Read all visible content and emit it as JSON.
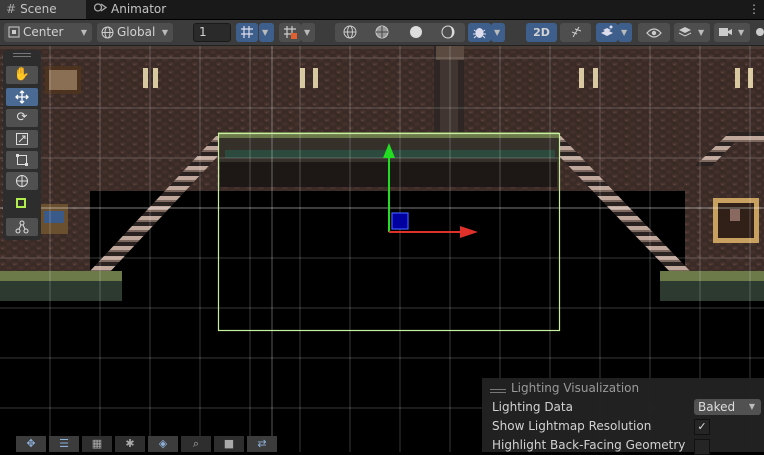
{
  "tabs": [
    {
      "label": "Scene",
      "icon": "grid-icon",
      "active": true
    },
    {
      "label": "Animator",
      "icon": "animator-icon",
      "active": false
    }
  ],
  "toolbar": {
    "pivot_mode": "Center",
    "pivot_rotation": "Global",
    "grid_snap_value": "1",
    "view_2d_label": "2D"
  },
  "overlay": {
    "title": "Lighting Visualization",
    "lighting_data_label": "Lighting Data",
    "lighting_data_value": "Baked",
    "lightmap_resolution_label": "Show Lightmap Resolution",
    "lightmap_resolution_checked": true,
    "backface_label": "Highlight Back-Facing Geometry",
    "backface_checked": false
  },
  "tools": [
    "view-tool-icon",
    "move-tool-icon",
    "rotate-tool-icon",
    "scale-tool-icon",
    "rect-tool-icon",
    "transform-tool-icon",
    "custom-tool-icon",
    "component-tool-icon"
  ],
  "colors": {
    "accent": "#3e5f8b",
    "selection": "#c6f0a0",
    "x_axis": "#e0302a",
    "y_axis": "#22dd22",
    "toolbar": "#3c3c3c"
  }
}
